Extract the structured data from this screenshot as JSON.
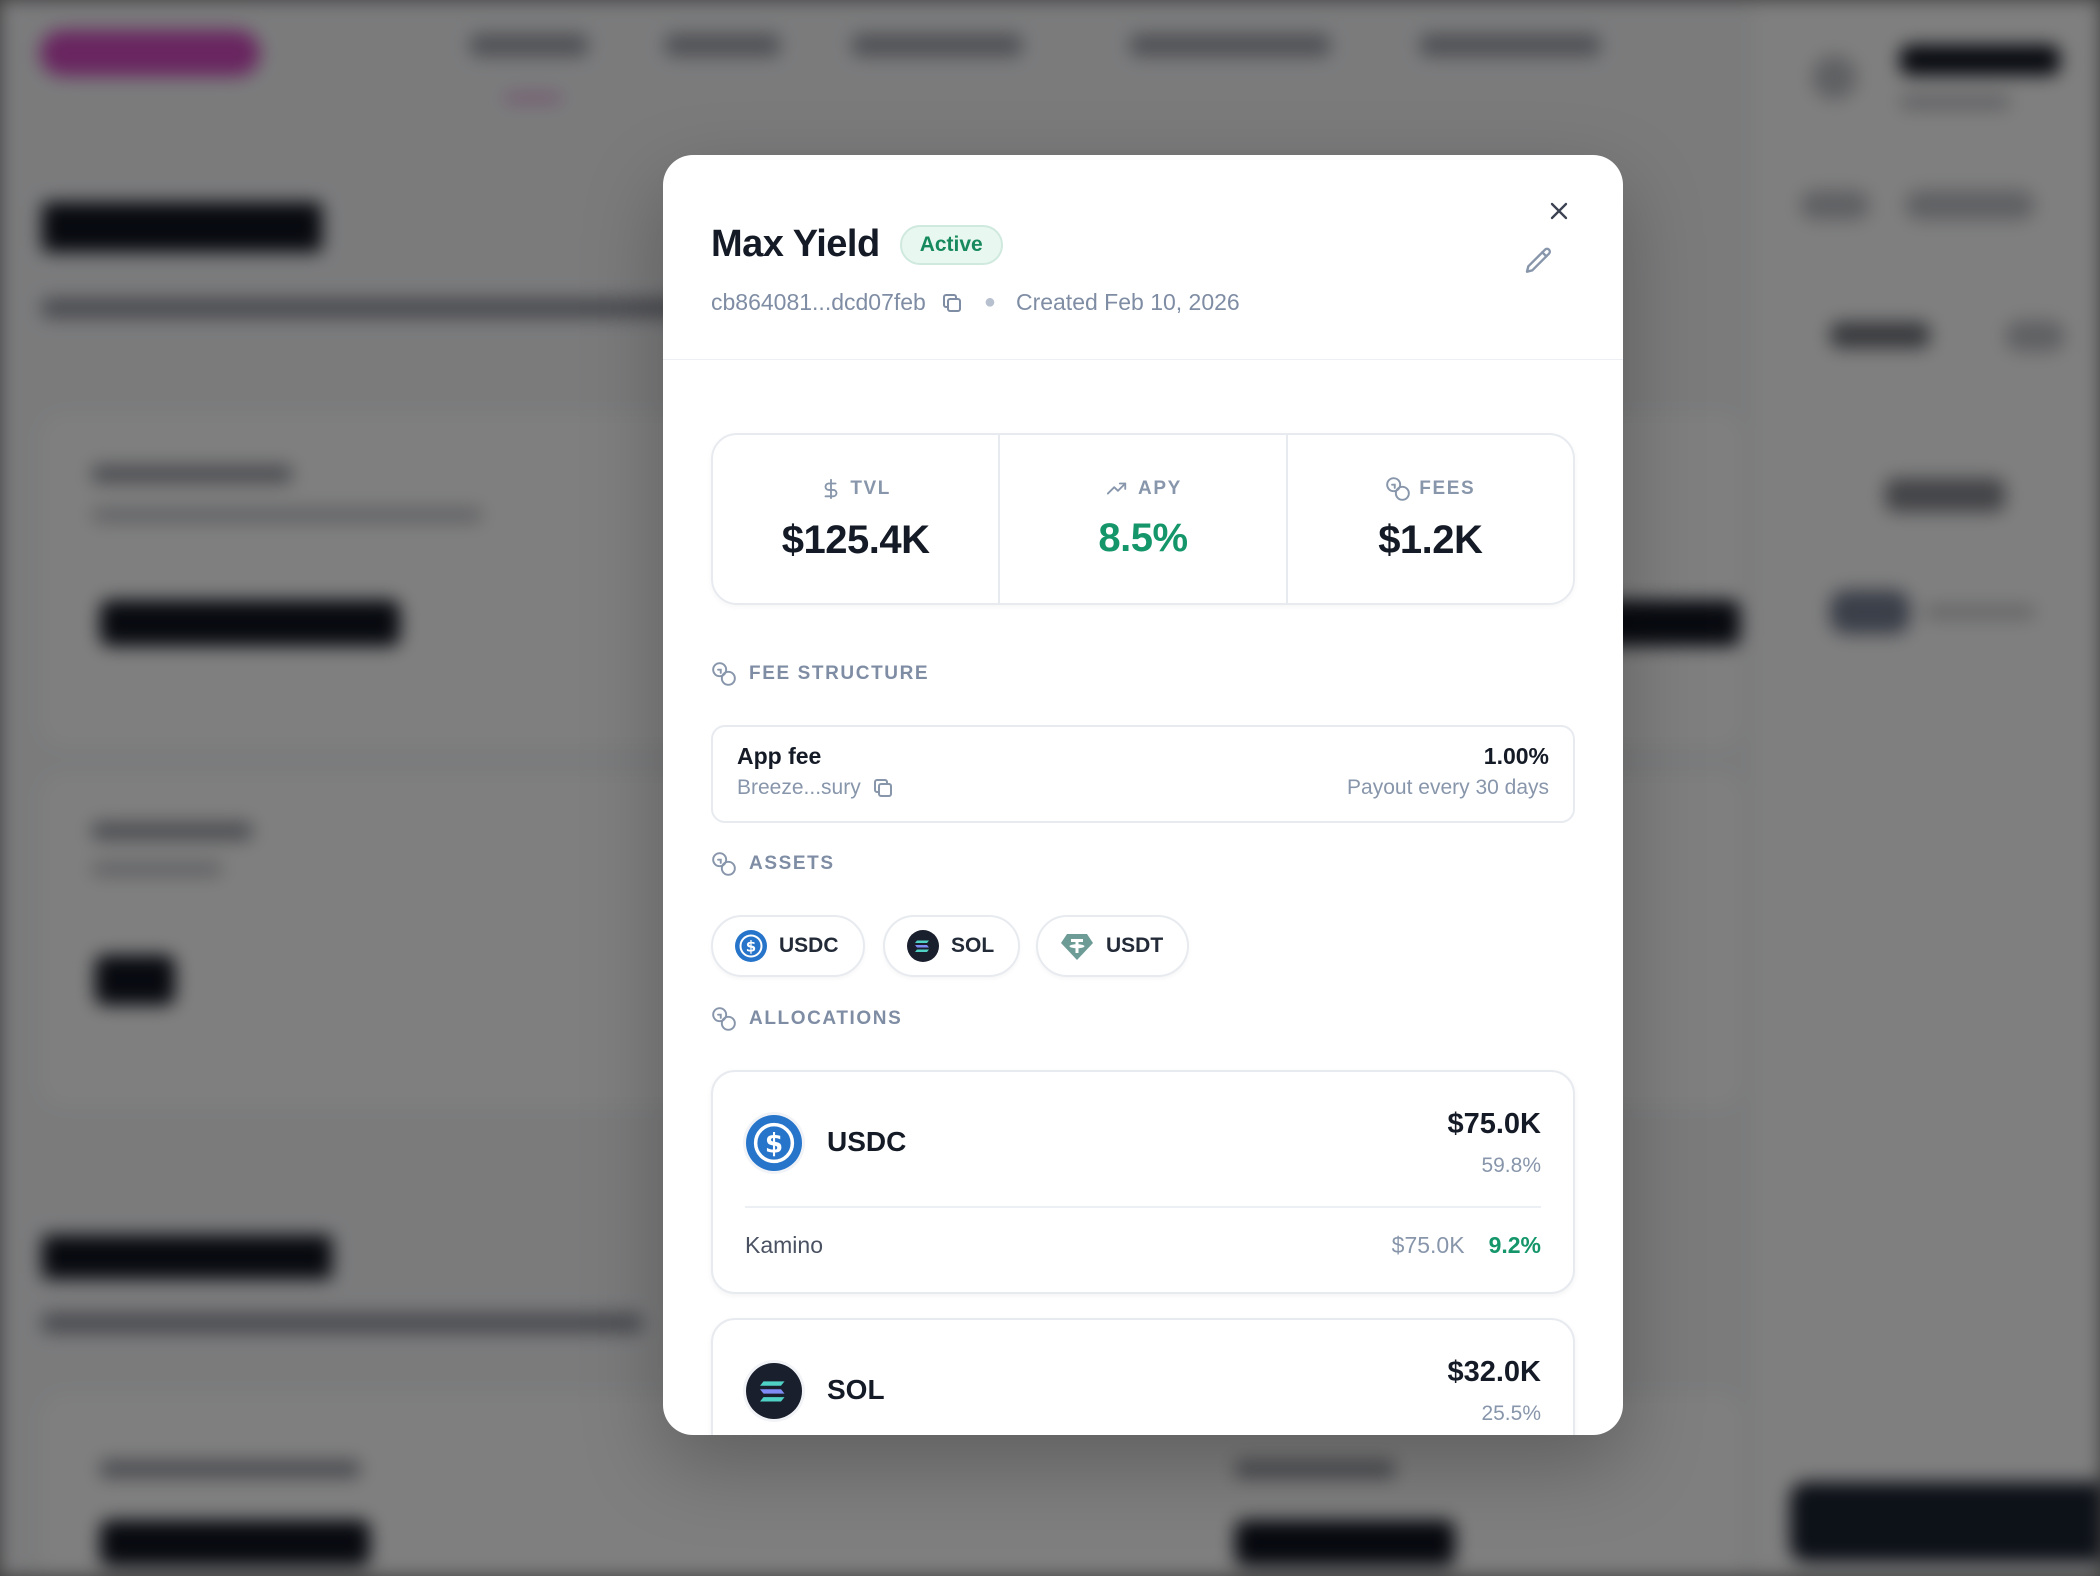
{
  "modal": {
    "title": "Max Yield",
    "status": "Active",
    "address": "cb864081...dcd07feb",
    "created": "Created Feb 10, 2026"
  },
  "stats": [
    {
      "label": "TVL",
      "value": "$125.4K",
      "icon": "dollar-icon"
    },
    {
      "label": "APY",
      "value": "8.5%",
      "icon": "trending-up-icon"
    },
    {
      "label": "FEES",
      "value": "$1.2K",
      "icon": "coins-icon"
    }
  ],
  "fee_structure": {
    "label": "FEE STRUCTURE",
    "title": "App fee",
    "address": "Breeze...sury",
    "percent": "1.00%",
    "payout": "Payout every 30 days"
  },
  "assets": {
    "label": "ASSETS",
    "items": [
      {
        "symbol": "USDC",
        "icon": "usdc-icon"
      },
      {
        "symbol": "SOL",
        "icon": "sol-icon"
      },
      {
        "symbol": "USDT",
        "icon": "usdt-icon"
      }
    ]
  },
  "allocations": {
    "label": "ALLOCATIONS",
    "items": [
      {
        "symbol": "USDC",
        "amount": "$75.0K",
        "share": "59.8%",
        "protocol": "Kamino",
        "protocol_amount": "$75.0K",
        "protocol_apy": "9.2%"
      },
      {
        "symbol": "SOL",
        "amount": "$32.0K",
        "share": "25.5%"
      }
    ]
  },
  "colors": {
    "accent_green": "#14966a",
    "usdc_blue": "#2775ca",
    "sol_dark": "#1a1f2e",
    "usdt_teal": "#6d9c96"
  }
}
